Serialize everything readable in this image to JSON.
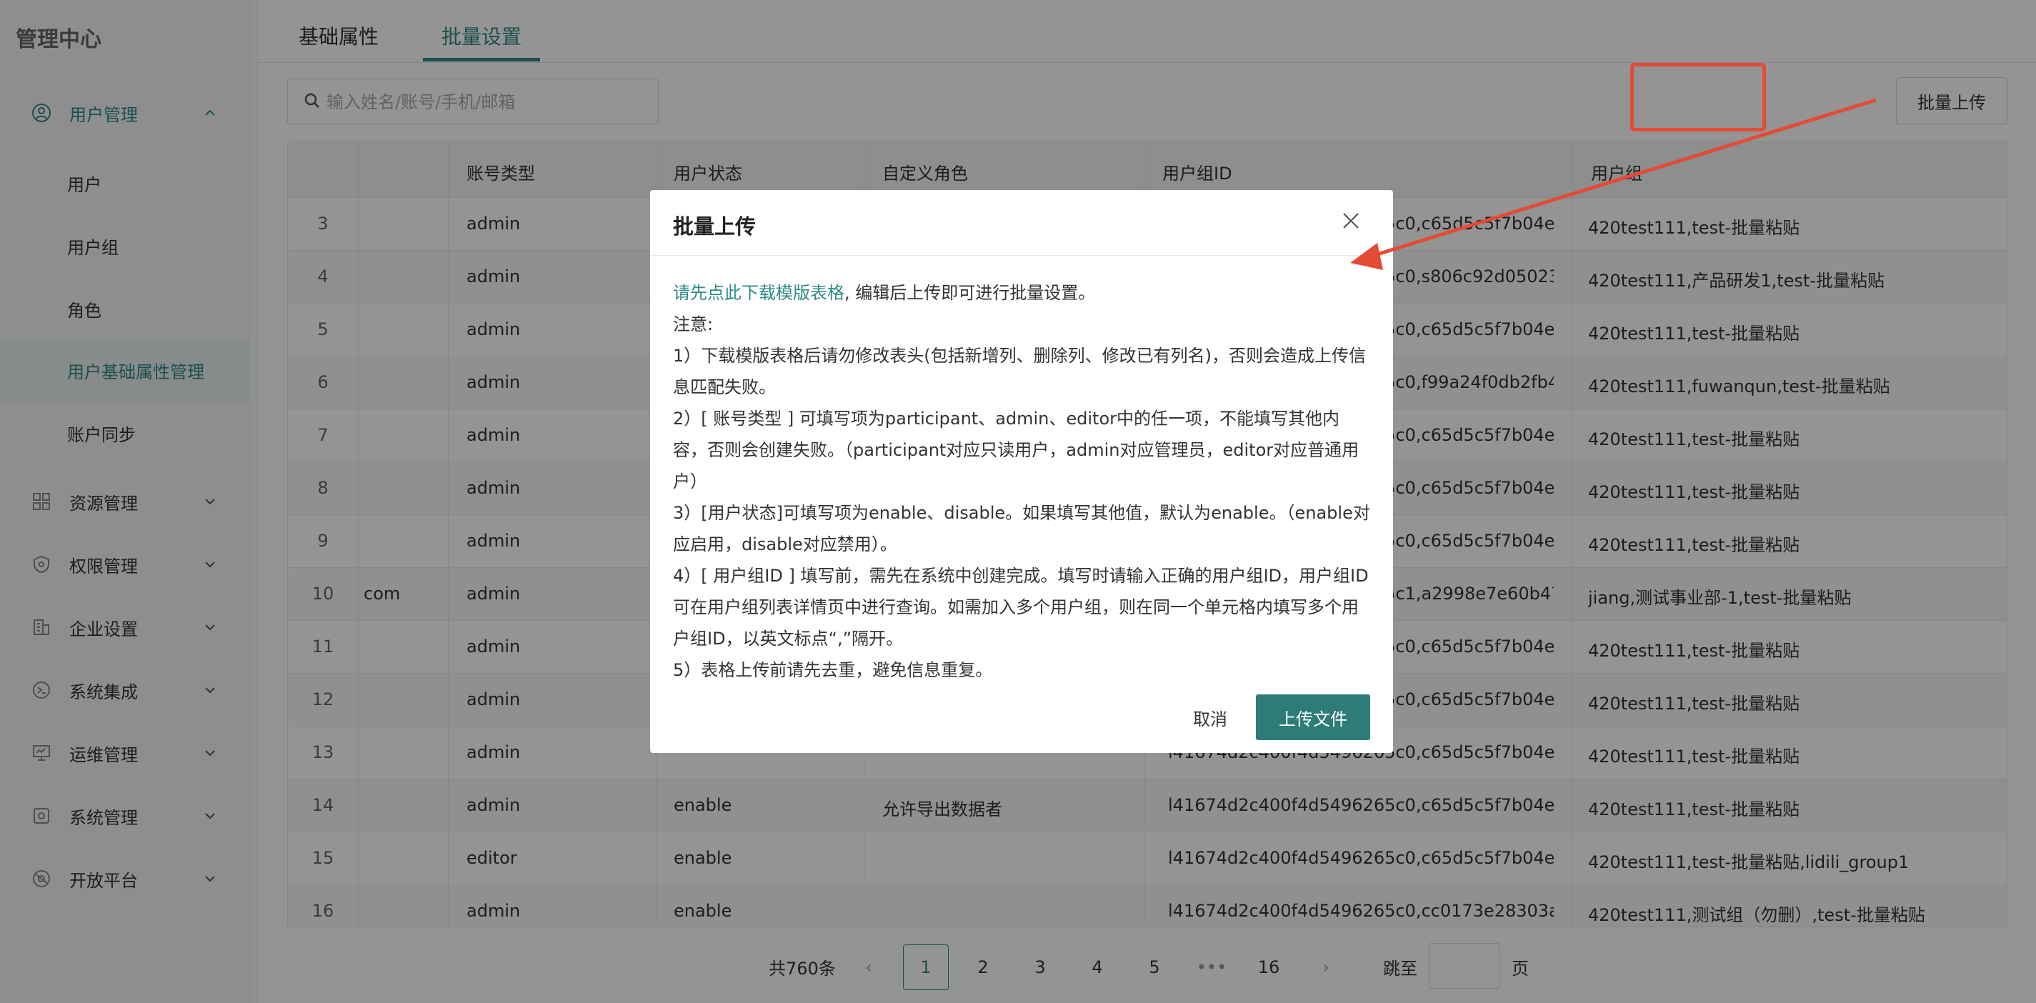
{
  "sidebar": {
    "brand": "管理中心",
    "user_mgmt": "用户管理",
    "sub_items": [
      "用户",
      "用户组",
      "角色",
      "用户基础属性管理",
      "账户同步"
    ],
    "groups": [
      "资源管理",
      "权限管理",
      "企业设置",
      "系统集成",
      "运维管理",
      "系统管理",
      "开放平台"
    ]
  },
  "tabs": [
    "基础属性",
    "批量设置"
  ],
  "search": {
    "placeholder": "输入姓名/账号/手机/邮箱"
  },
  "toolbar": {
    "batch_upload": "批量上传"
  },
  "table": {
    "headers": [
      "账号类型",
      "用户状态",
      "自定义角色",
      "用户组ID",
      "用户组"
    ],
    "rows": [
      {
        "no": "3",
        "c1": "",
        "type": "admin",
        "status": "",
        "role": "",
        "gid": "l41674d2c400f4d5496265c0,c65d5c5f7b04e...",
        "group": "420test111,test-批量粘贴"
      },
      {
        "no": "4",
        "c1": "",
        "type": "admin",
        "status": "",
        "role": "",
        "gid": "l41674d2c400f4d5496265c0,s806c92d05023...",
        "group": "420test111,产品研发1,test-批量粘贴"
      },
      {
        "no": "5",
        "c1": "",
        "type": "admin",
        "status": "",
        "role": "",
        "gid": "l41674d2c400f4d5496265c0,c65d5c5f7b04e...",
        "group": "420test111,test-批量粘贴"
      },
      {
        "no": "6",
        "c1": "",
        "type": "admin",
        "status": "",
        "role": "",
        "gid": "l41674d2c400f4d5496265c0,f99a24f0db2fb4...",
        "group": "420test111,fuwanqun,test-批量粘贴"
      },
      {
        "no": "7",
        "c1": "",
        "type": "admin",
        "status": "",
        "role": "",
        "gid": "l41674d2c400f4d5496265c0,c65d5c5f7b04e...",
        "group": "420test111,test-批量粘贴"
      },
      {
        "no": "8",
        "c1": "",
        "type": "admin",
        "status": "",
        "role": "",
        "gid": "l41674d2c400f4d5496265c0,c65d5c5f7b04e...",
        "group": "420test111,test-批量粘贴"
      },
      {
        "no": "9",
        "c1": "",
        "type": "admin",
        "status": "",
        "role": "",
        "gid": "l41674d2c400f4d5496265c0,c65d5c5f7b04e...",
        "group": "420test111,test-批量粘贴"
      },
      {
        "no": "10",
        "c1": "com",
        "type": "admin",
        "status": "",
        "role": "",
        "gid": "l41674d2c400f4d5496265c1,a2998e7e60b47...",
        "group": "jiang,测试事业部-1,test-批量粘贴"
      },
      {
        "no": "11",
        "c1": "",
        "type": "admin",
        "status": "",
        "role": "",
        "gid": "l41674d2c400f4d5496265c0,c65d5c5f7b04e...",
        "group": "420test111,test-批量粘贴"
      },
      {
        "no": "12",
        "c1": "",
        "type": "admin",
        "status": "",
        "role": "",
        "gid": "l41674d2c400f4d5496265c0,c65d5c5f7b04e...",
        "group": "420test111,test-批量粘贴"
      },
      {
        "no": "13",
        "c1": "",
        "type": "admin",
        "status": "",
        "role": "",
        "gid": "l41674d2c400f4d5496265c0,c65d5c5f7b04e...",
        "group": "420test111,test-批量粘贴"
      },
      {
        "no": "14",
        "c1": "",
        "type": "admin",
        "status": "enable",
        "role": "允许导出数据者",
        "gid": "l41674d2c400f4d5496265c0,c65d5c5f7b04e...",
        "group": "420test111,test-批量粘贴"
      },
      {
        "no": "15",
        "c1": "",
        "type": "editor",
        "status": "enable",
        "role": "",
        "gid": "l41674d2c400f4d5496265c0,c65d5c5f7b04e...",
        "group": "420test111,test-批量粘贴,lidili_group1"
      },
      {
        "no": "16",
        "c1": "",
        "type": "admin",
        "status": "enable",
        "role": "",
        "gid": "l41674d2c400f4d5496265c0,cc0173e28303a...",
        "group": "420test111,测试组（勿删）,test-批量粘贴"
      }
    ]
  },
  "pagination": {
    "total": "共760条",
    "pages": [
      "1",
      "2",
      "3",
      "4",
      "5"
    ],
    "ellipsis": "•••",
    "last": "16",
    "goto": "跳至",
    "page_unit": "页",
    "prev": "‹",
    "next": "›"
  },
  "modal": {
    "title": "批量上传",
    "link_text": "请先点此下载模版表格",
    "intro_rest": ", 编辑后上传即可进行批量设置。",
    "note": "注意:",
    "items": [
      "1）下载模版表格后请勿修改表头(包括新增列、删除列、修改已有列名)，否则会造成上传信息匹配失败。",
      "2）[ 账号类型 ] 可填写项为participant、admin、editor中的任一项，不能填写其他内容，否则会创建失败。（participant对应只读用户，admin对应管理员，editor对应普通用户）",
      "3）[用户状态]可填写项为enable、disable。如果填写其他值，默认为enable。（enable对应启用，disable对应禁用）。",
      "4）[ 用户组ID ] 填写前，需先在系统中创建完成。填写时请输入正确的用户组ID，用户组ID可在用户组列表详情页中进行查询。如需加入多个用户组，则在同一个单元格内填写多个用户组ID，以英文标点“,”隔开。",
      "5）表格上传前请先去重，避免信息重复。"
    ],
    "cancel": "取消",
    "upload": "上传文件"
  },
  "colors": {
    "accent": "#2e8a85",
    "primary_button": "#2e7c78",
    "annotation": "#e34b36"
  }
}
